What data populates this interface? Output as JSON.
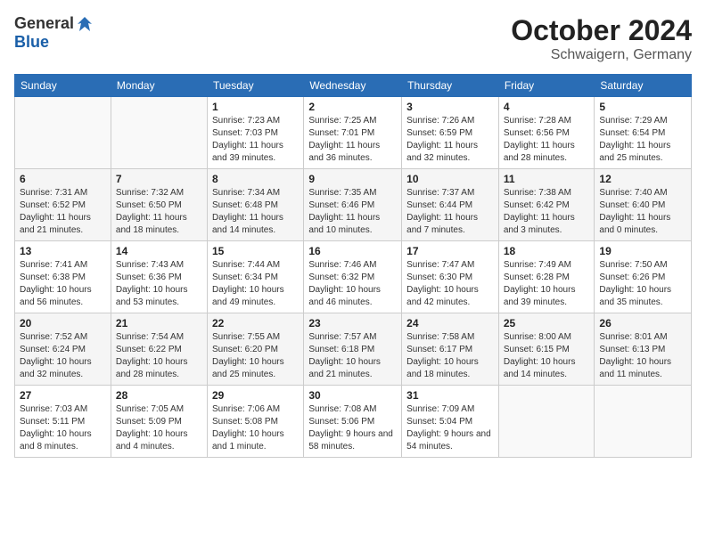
{
  "header": {
    "logo_general": "General",
    "logo_blue": "Blue",
    "month": "October 2024",
    "location": "Schwaigern, Germany"
  },
  "weekdays": [
    "Sunday",
    "Monday",
    "Tuesday",
    "Wednesday",
    "Thursday",
    "Friday",
    "Saturday"
  ],
  "weeks": [
    [
      {
        "day": "",
        "info": ""
      },
      {
        "day": "",
        "info": ""
      },
      {
        "day": "1",
        "info": "Sunrise: 7:23 AM\nSunset: 7:03 PM\nDaylight: 11 hours and 39 minutes."
      },
      {
        "day": "2",
        "info": "Sunrise: 7:25 AM\nSunset: 7:01 PM\nDaylight: 11 hours and 36 minutes."
      },
      {
        "day": "3",
        "info": "Sunrise: 7:26 AM\nSunset: 6:59 PM\nDaylight: 11 hours and 32 minutes."
      },
      {
        "day": "4",
        "info": "Sunrise: 7:28 AM\nSunset: 6:56 PM\nDaylight: 11 hours and 28 minutes."
      },
      {
        "day": "5",
        "info": "Sunrise: 7:29 AM\nSunset: 6:54 PM\nDaylight: 11 hours and 25 minutes."
      }
    ],
    [
      {
        "day": "6",
        "info": "Sunrise: 7:31 AM\nSunset: 6:52 PM\nDaylight: 11 hours and 21 minutes."
      },
      {
        "day": "7",
        "info": "Sunrise: 7:32 AM\nSunset: 6:50 PM\nDaylight: 11 hours and 18 minutes."
      },
      {
        "day": "8",
        "info": "Sunrise: 7:34 AM\nSunset: 6:48 PM\nDaylight: 11 hours and 14 minutes."
      },
      {
        "day": "9",
        "info": "Sunrise: 7:35 AM\nSunset: 6:46 PM\nDaylight: 11 hours and 10 minutes."
      },
      {
        "day": "10",
        "info": "Sunrise: 7:37 AM\nSunset: 6:44 PM\nDaylight: 11 hours and 7 minutes."
      },
      {
        "day": "11",
        "info": "Sunrise: 7:38 AM\nSunset: 6:42 PM\nDaylight: 11 hours and 3 minutes."
      },
      {
        "day": "12",
        "info": "Sunrise: 7:40 AM\nSunset: 6:40 PM\nDaylight: 11 hours and 0 minutes."
      }
    ],
    [
      {
        "day": "13",
        "info": "Sunrise: 7:41 AM\nSunset: 6:38 PM\nDaylight: 10 hours and 56 minutes."
      },
      {
        "day": "14",
        "info": "Sunrise: 7:43 AM\nSunset: 6:36 PM\nDaylight: 10 hours and 53 minutes."
      },
      {
        "day": "15",
        "info": "Sunrise: 7:44 AM\nSunset: 6:34 PM\nDaylight: 10 hours and 49 minutes."
      },
      {
        "day": "16",
        "info": "Sunrise: 7:46 AM\nSunset: 6:32 PM\nDaylight: 10 hours and 46 minutes."
      },
      {
        "day": "17",
        "info": "Sunrise: 7:47 AM\nSunset: 6:30 PM\nDaylight: 10 hours and 42 minutes."
      },
      {
        "day": "18",
        "info": "Sunrise: 7:49 AM\nSunset: 6:28 PM\nDaylight: 10 hours and 39 minutes."
      },
      {
        "day": "19",
        "info": "Sunrise: 7:50 AM\nSunset: 6:26 PM\nDaylight: 10 hours and 35 minutes."
      }
    ],
    [
      {
        "day": "20",
        "info": "Sunrise: 7:52 AM\nSunset: 6:24 PM\nDaylight: 10 hours and 32 minutes."
      },
      {
        "day": "21",
        "info": "Sunrise: 7:54 AM\nSunset: 6:22 PM\nDaylight: 10 hours and 28 minutes."
      },
      {
        "day": "22",
        "info": "Sunrise: 7:55 AM\nSunset: 6:20 PM\nDaylight: 10 hours and 25 minutes."
      },
      {
        "day": "23",
        "info": "Sunrise: 7:57 AM\nSunset: 6:18 PM\nDaylight: 10 hours and 21 minutes."
      },
      {
        "day": "24",
        "info": "Sunrise: 7:58 AM\nSunset: 6:17 PM\nDaylight: 10 hours and 18 minutes."
      },
      {
        "day": "25",
        "info": "Sunrise: 8:00 AM\nSunset: 6:15 PM\nDaylight: 10 hours and 14 minutes."
      },
      {
        "day": "26",
        "info": "Sunrise: 8:01 AM\nSunset: 6:13 PM\nDaylight: 10 hours and 11 minutes."
      }
    ],
    [
      {
        "day": "27",
        "info": "Sunrise: 7:03 AM\nSunset: 5:11 PM\nDaylight: 10 hours and 8 minutes."
      },
      {
        "day": "28",
        "info": "Sunrise: 7:05 AM\nSunset: 5:09 PM\nDaylight: 10 hours and 4 minutes."
      },
      {
        "day": "29",
        "info": "Sunrise: 7:06 AM\nSunset: 5:08 PM\nDaylight: 10 hours and 1 minute."
      },
      {
        "day": "30",
        "info": "Sunrise: 7:08 AM\nSunset: 5:06 PM\nDaylight: 9 hours and 58 minutes."
      },
      {
        "day": "31",
        "info": "Sunrise: 7:09 AM\nSunset: 5:04 PM\nDaylight: 9 hours and 54 minutes."
      },
      {
        "day": "",
        "info": ""
      },
      {
        "day": "",
        "info": ""
      }
    ]
  ]
}
